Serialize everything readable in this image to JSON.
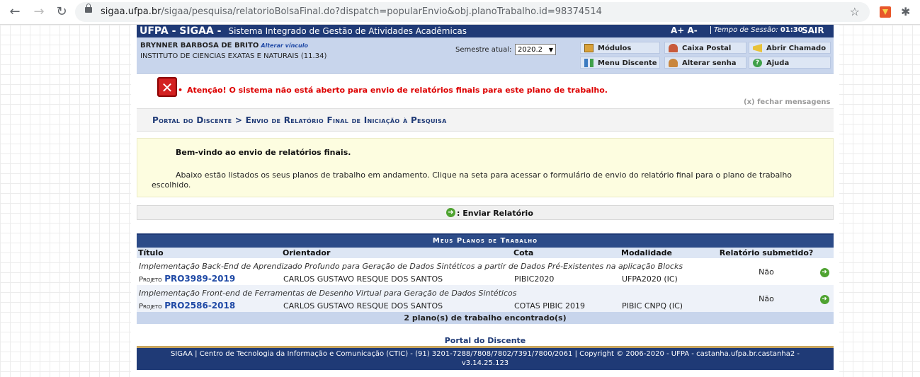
{
  "browser": {
    "url_host": "sigaa.ufpa.br",
    "url_path": "/sigaa/pesquisa/relatorioBolsaFinal.do?dispatch=popularEnvio&obj.planoTrabalho.id=98374514"
  },
  "header": {
    "system": "UFPA - SIGAA -",
    "system_desc": "Sistema Integrado de Gestão de Atividades Acadêmicas",
    "font_controls": "A+ A-",
    "session_label": "Tempo de Sessão:",
    "session_time": "01:30",
    "logout": "SAIR"
  },
  "user": {
    "name": "BRYNNER BARBOSA DE BRITO",
    "change_link": "Alterar vínculo",
    "institute": "INSTITUTO DE CIENCIAS EXATAS E NATURAIS (11.34)",
    "semester_label": "Semestre atual:",
    "semester_value": "2020.2"
  },
  "menu": {
    "modulos": "Módulos",
    "caixa_postal": "Caixa Postal",
    "abrir_chamado": "Abrir Chamado",
    "menu_discente": "Menu Discente",
    "alterar_senha": "Alterar senha",
    "ajuda": "Ajuda"
  },
  "message": {
    "text": "Atenção! O sistema não está aberto para envio de relatórios finais para este plano de trabalho.",
    "close": "(x) fechar mensagens"
  },
  "breadcrumb": "Portal do Discente > Envio de Relatório Final de Iniciação à Pesquisa",
  "intro": {
    "title": "Bem-vindo ao envio de relatórios finais.",
    "text": "Abaixo estão listados os seus planos de trabalho em andamento. Clique na seta para acessar o formulário de envio do relatório final para o plano de trabalho escolhido."
  },
  "action": {
    "label": ": Enviar Relatório"
  },
  "plans": {
    "caption": "Meus Planos de Trabalho",
    "headers": [
      "Título",
      "Orientador",
      "Cota",
      "Modalidade",
      "Relatório submetido?"
    ],
    "project_prefix": "Projeto",
    "rows": [
      {
        "title": "Implementação Back-End de Aprendizado Profundo para Geração de Dados Sintéticos a partir de Dados Pré-Existentes na aplicação Blocks",
        "code": "PRO3989-2019",
        "advisor": "CARLOS GUSTAVO RESQUE DOS SANTOS",
        "quota": "PIBIC2020",
        "modality": "UFPA2020 (IC)",
        "submitted": "Não"
      },
      {
        "title": "Implementação Front-end de Ferramentas de Desenho Virtual para Geração de Dados Sintéticos",
        "code": "PRO2586-2018",
        "advisor": "CARLOS GUSTAVO RESQUE DOS SANTOS",
        "quota": "COTAS PIBIC 2019",
        "modality": "PIBIC CNPQ (IC)",
        "submitted": "Não"
      }
    ],
    "footer": "2 plano(s) de trabalho encontrado(s)"
  },
  "portal_link": "Portal do Discente",
  "footer": {
    "line1": "SIGAA | Centro de Tecnologia da Informação e Comunicação (CTIC) - (91) 3201-7288/7808/7802/7391/7800/2061 | Copyright © 2006-2020 - UFPA - castanha.ufpa.br.castanha2 -",
    "line2": "v3.14.25.123"
  },
  "colors": {
    "header": "#1f3a76",
    "error": "#dd0000",
    "go": "#4fa331"
  }
}
